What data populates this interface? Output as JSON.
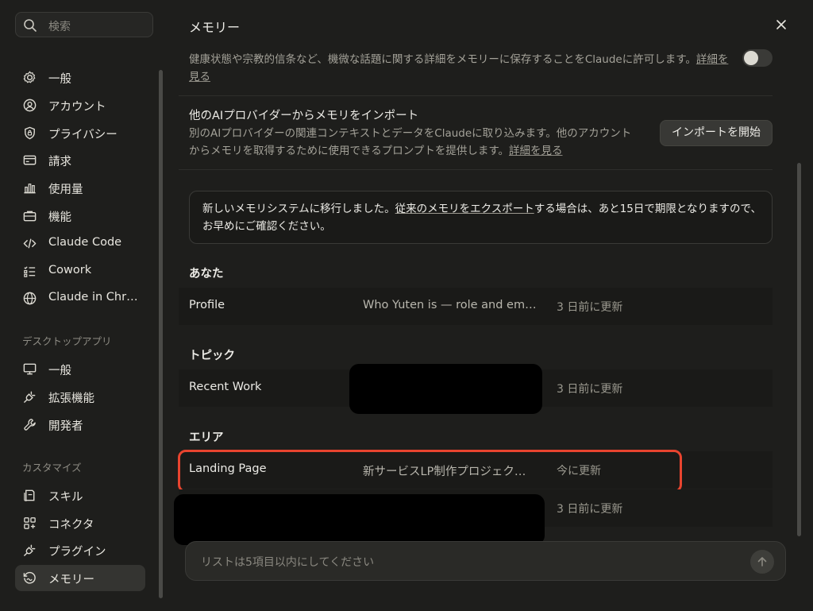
{
  "sidebar": {
    "search_placeholder": "検索",
    "items": [
      {
        "label": "一般",
        "icon": "gear-icon"
      },
      {
        "label": "アカウント",
        "icon": "user-circle-icon"
      },
      {
        "label": "プライバシー",
        "icon": "shield-icon"
      },
      {
        "label": "請求",
        "icon": "credit-card-icon"
      },
      {
        "label": "使用量",
        "icon": "bar-chart-icon"
      },
      {
        "label": "機能",
        "icon": "briefcase-icon"
      },
      {
        "label": "Claude Code",
        "icon": "code-icon"
      },
      {
        "label": "Cowork",
        "icon": "checklist-icon"
      },
      {
        "label": "Claude in Chr…",
        "icon": "globe-icon"
      }
    ],
    "desktop_section_label": "デスクトップアプリ",
    "desktop_items": [
      {
        "label": "一般",
        "icon": "monitor-icon"
      },
      {
        "label": "拡張機能",
        "icon": "plug-icon"
      },
      {
        "label": "開発者",
        "icon": "wrench-icon"
      }
    ],
    "customize_section_label": "カスタマイズ",
    "customize_items": [
      {
        "label": "スキル",
        "icon": "skill-doc-icon"
      },
      {
        "label": "コネクタ",
        "icon": "connector-grid-icon"
      },
      {
        "label": "プラグイン",
        "icon": "plugin-icon"
      },
      {
        "label": "メモリー",
        "icon": "memory-icon",
        "active": true
      }
    ]
  },
  "main": {
    "title": "メモリー",
    "sensitive": {
      "text": "健康状態や宗教的信条など、機微な話題に関する詳細をメモリーに保存することをClaudeに許可します。",
      "link": "詳細を見る",
      "toggle_on": false
    },
    "import": {
      "title": "他のAIプロバイダーからメモリをインポート",
      "description": "別のAIプロバイダーの関連コンテキストとデータをClaudeに取り込みます。他のアカウントからメモリを取得するために使用できるプロンプトを提供します。",
      "link": "詳細を見る",
      "button": "インポートを開始"
    },
    "notice": {
      "text_before": "新しいメモリシステムに移行しました。",
      "link": "従来のメモリをエクスポート",
      "text_after": "する場合は、あと15日で期限となりますので、お早めにご確認ください。"
    },
    "groups": {
      "you": {
        "label": "あなた",
        "rows": [
          {
            "name": "Profile",
            "summary": "Who Yuten is — role and emp…",
            "updated": "3 日前に更新"
          }
        ]
      },
      "topics": {
        "label": "トピック",
        "rows": [
          {
            "name": "Recent Work",
            "summary": "",
            "updated": "3 日前に更新"
          }
        ]
      },
      "areas": {
        "label": "エリア",
        "rows": [
          {
            "name": "Landing Page",
            "summary": "新サービスLP制作プロジェク…",
            "updated": "今に更新"
          },
          {
            "name": "",
            "summary": "",
            "updated": "3 日前に更新"
          }
        ]
      }
    },
    "chat_placeholder": "リストは5項目以内にしてください"
  }
}
